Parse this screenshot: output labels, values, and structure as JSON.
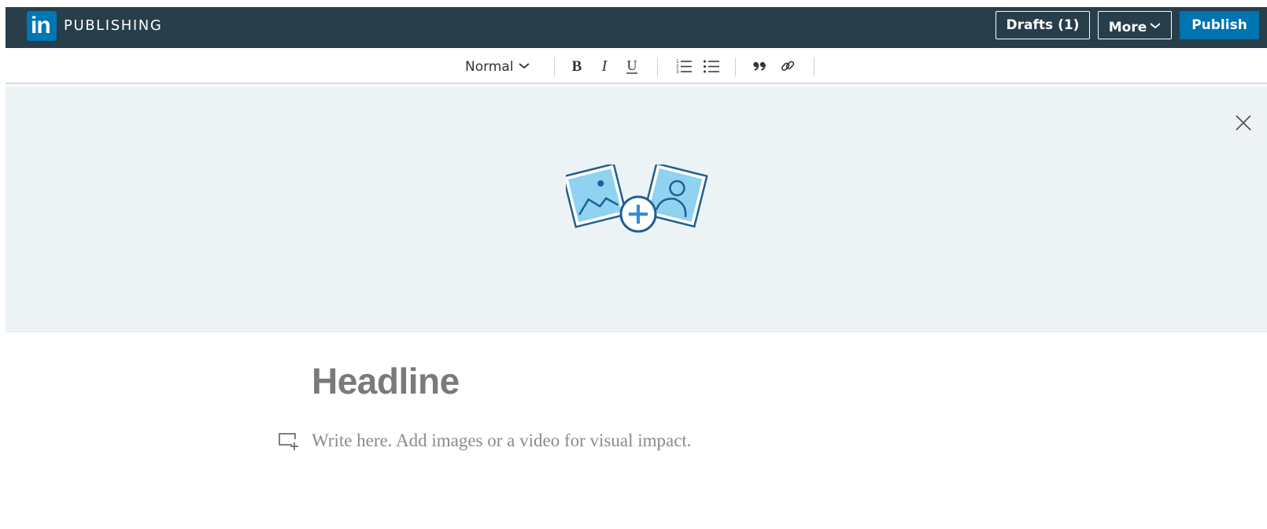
{
  "header": {
    "logo_text": "in",
    "brand": "PUBLISHING",
    "drafts_label": "Drafts (1)",
    "more_label": "More",
    "publish_label": "Publish"
  },
  "toolbar": {
    "text_style": "Normal",
    "icons": [
      "bold-icon",
      "italic-icon",
      "underline-icon",
      "numbered-list-icon",
      "bulleted-list-icon",
      "quote-icon",
      "link-icon"
    ]
  },
  "cover": {
    "icons": [
      "image-placeholder-icon",
      "add-icon",
      "profile-photo-icon",
      "close-icon"
    ]
  },
  "editor": {
    "headline_placeholder": "Headline",
    "body_placeholder": "Write here. Add images or a video for visual impact."
  },
  "colors": {
    "topbar": "#283e4a",
    "brand_blue": "#0077b5",
    "cover_bg": "#edf3f4",
    "placeholder": "#8a8a8a"
  }
}
